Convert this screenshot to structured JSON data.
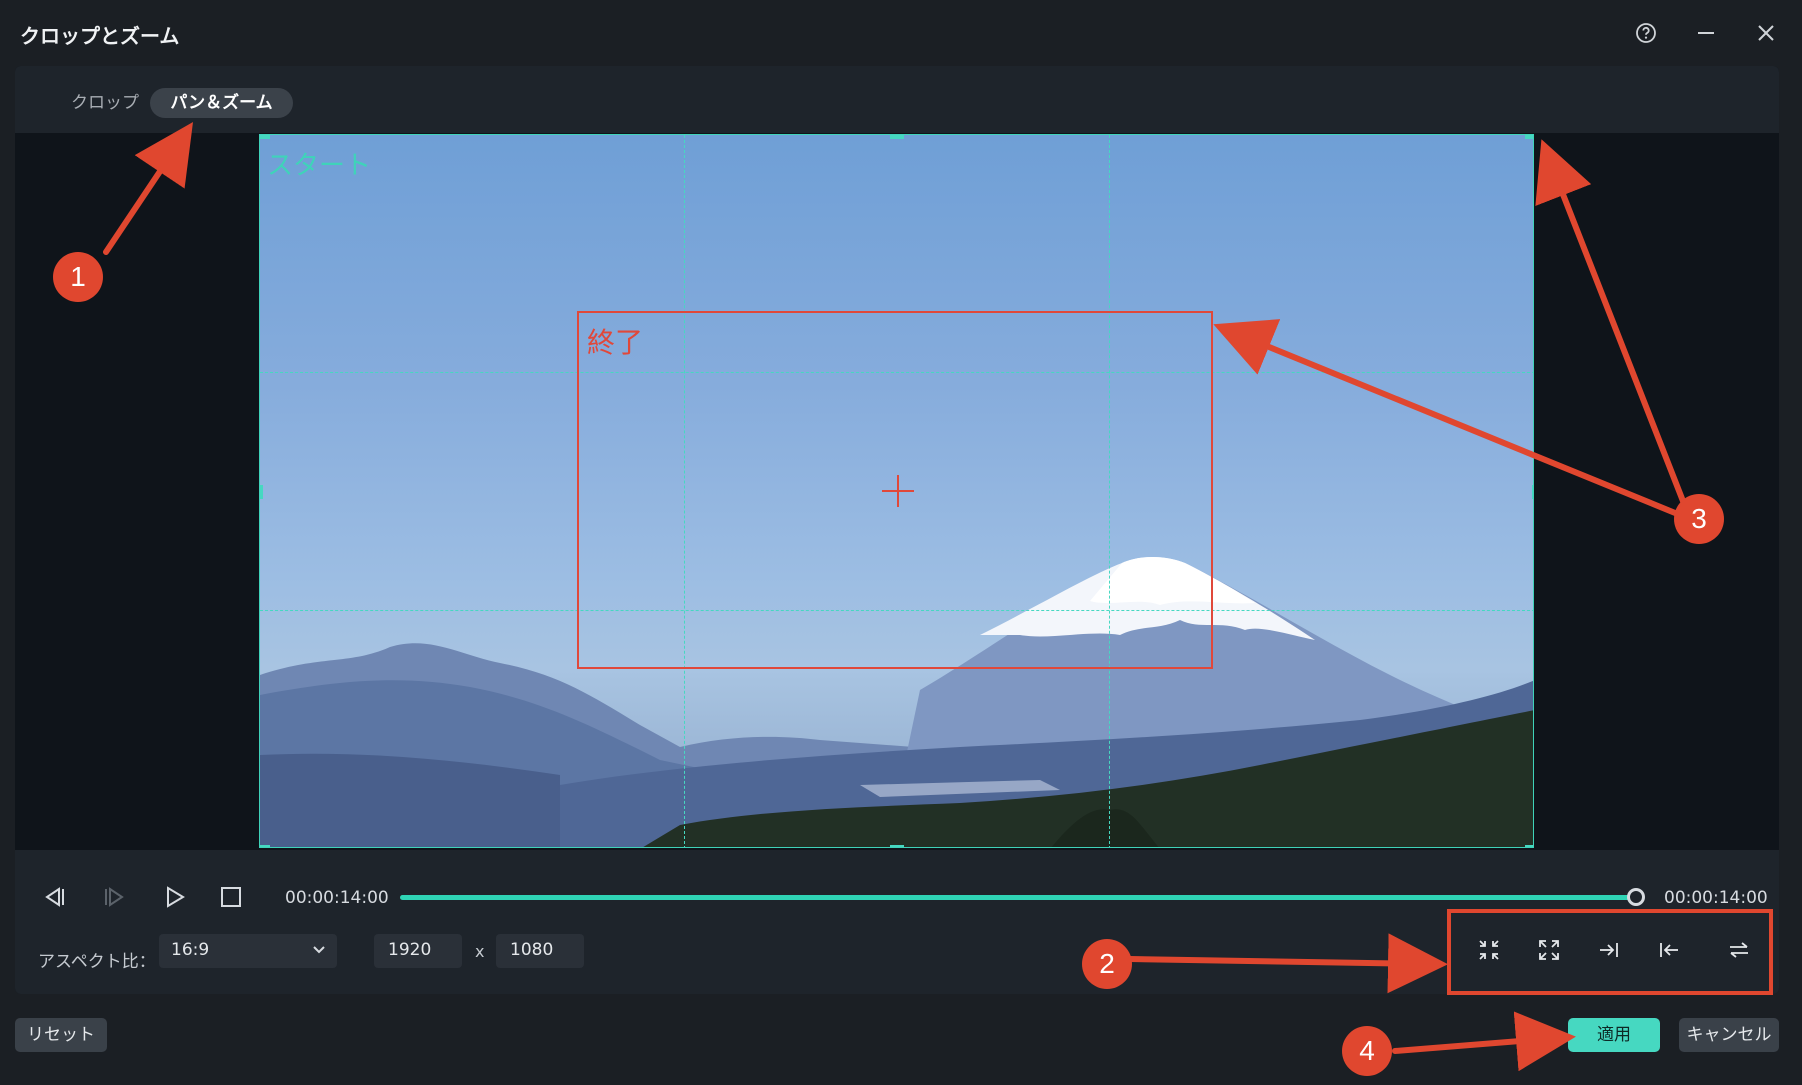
{
  "window": {
    "title": "クロップとズーム",
    "help_icon": "help-circle-icon",
    "minimize_icon": "minimize-icon",
    "close_icon": "close-icon"
  },
  "tabs": [
    {
      "label": "クロップ",
      "active": false
    },
    {
      "label": "パン＆ズーム",
      "active": true
    }
  ],
  "preview": {
    "start_label": "スタート",
    "end_label": "終了",
    "start_frame_color": "#3fd3b9",
    "end_frame_color": "#e0483a"
  },
  "playback": {
    "prev_frame_icon": "step-back-icon",
    "next_frame_icon": "step-forward-icon",
    "play_icon": "play-icon",
    "stop_icon": "stop-icon",
    "current_time": "00:00:14:00",
    "total_time": "00:00:14:00",
    "progress": 1.0
  },
  "aspect": {
    "label": "アスペクト比：",
    "value": "16:9",
    "width": "1920",
    "separator": "x",
    "height": "1080"
  },
  "tools": [
    {
      "icon": "shrink-icon"
    },
    {
      "icon": "expand-icon"
    },
    {
      "icon": "align-to-end-icon"
    },
    {
      "icon": "align-to-start-icon"
    },
    {
      "icon": "swap-icon"
    }
  ],
  "buttons": {
    "reset": "リセット",
    "apply": "適用",
    "cancel": "キャンセル"
  },
  "annotations": {
    "badge1": "1",
    "badge2": "2",
    "badge3": "3",
    "badge4": "4",
    "color": "#e0472f"
  }
}
